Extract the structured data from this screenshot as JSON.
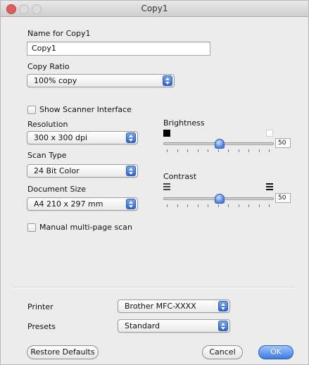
{
  "window": {
    "title": "Copy1"
  },
  "name": {
    "label": "Name for Copy1",
    "value": "Copy1"
  },
  "copy_ratio": {
    "label": "Copy Ratio",
    "value": "100% copy"
  },
  "show_scanner_interface": {
    "label": "Show Scanner Interface",
    "checked": false
  },
  "resolution": {
    "label": "Resolution",
    "value": "300 x 300 dpi"
  },
  "scan_type": {
    "label": "Scan Type",
    "value": "24 Bit Color"
  },
  "document_size": {
    "label": "Document Size",
    "value": "A4  210 x 297 mm"
  },
  "manual_multi_page_scan": {
    "label": "Manual multi-page scan",
    "checked": false
  },
  "brightness": {
    "label": "Brightness",
    "value": "50"
  },
  "contrast": {
    "label": "Contrast",
    "value": "50"
  },
  "printer": {
    "label": "Printer",
    "value": "Brother MFC-XXXX"
  },
  "presets": {
    "label": "Presets",
    "value": "Standard"
  },
  "buttons": {
    "restore_defaults": "Restore Defaults",
    "cancel": "Cancel",
    "ok": "OK"
  }
}
